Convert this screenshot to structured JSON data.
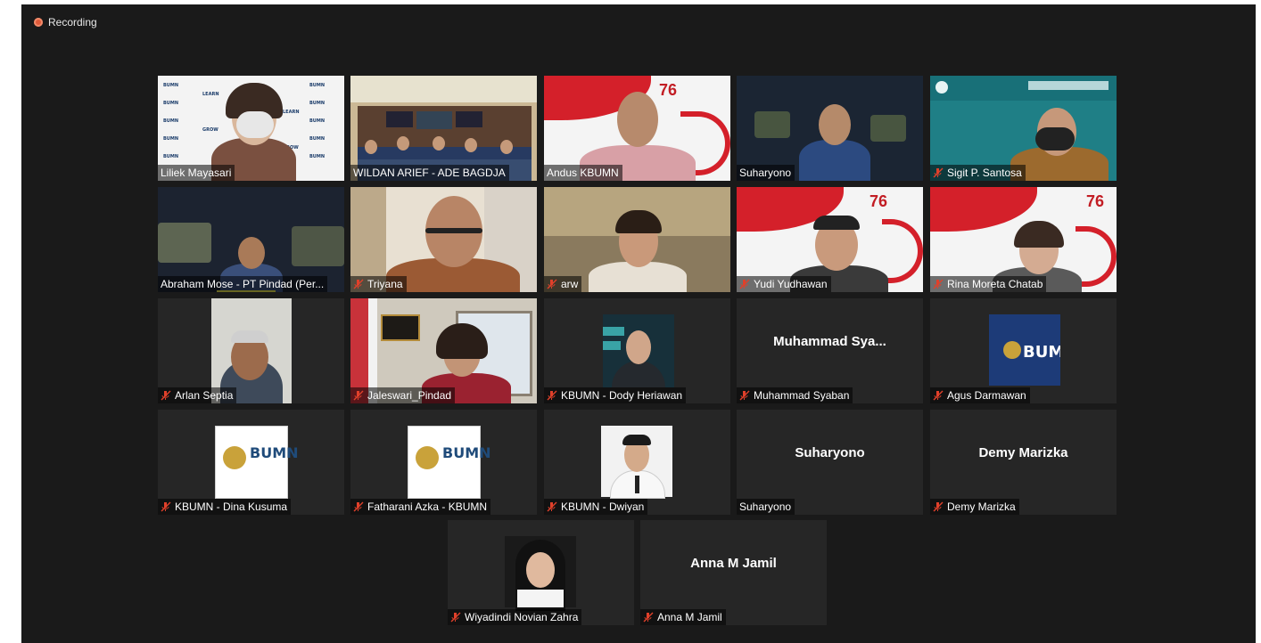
{
  "recording": {
    "label": "Recording"
  },
  "participants": [
    {
      "name": "Liliek Mayasari",
      "muted": false,
      "video": true
    },
    {
      "name": "WILDAN ARIEF - ADE BAGDJA",
      "muted": false,
      "video": true,
      "active_speaker": true
    },
    {
      "name": "Andus KBUMN",
      "muted": false,
      "video": true
    },
    {
      "name": "Suharyono",
      "muted": false,
      "video": true
    },
    {
      "name": "Sigit P. Santosa",
      "muted": true,
      "video": true
    },
    {
      "name": "Abraham Mose - PT Pindad (Per...",
      "muted": false,
      "video": true
    },
    {
      "name": "Triyana",
      "muted": true,
      "video": true
    },
    {
      "name": "arw",
      "muted": true,
      "video": true
    },
    {
      "name": "Yudi Yudhawan",
      "muted": true,
      "video": true
    },
    {
      "name": "Rina Moreta Chatab",
      "muted": true,
      "video": true
    },
    {
      "name": "Arlan Septia",
      "muted": true,
      "video": true
    },
    {
      "name": "Jaleswari_Pindad",
      "muted": true,
      "video": true
    },
    {
      "name": "KBUMN - Dody Heriawan",
      "muted": true,
      "video": true
    },
    {
      "name": "Muhammad Syaban",
      "muted": true,
      "video": false,
      "display_name": "Muhammad  Sya..."
    },
    {
      "name": "Agus Darmawan",
      "muted": true,
      "video": true
    },
    {
      "name": "KBUMN - Dina Kusuma",
      "muted": true,
      "video": true
    },
    {
      "name": "Fatharani Azka - KBUMN",
      "muted": true,
      "video": true
    },
    {
      "name": "KBUMN - Dwiyan",
      "muted": true,
      "video": true
    },
    {
      "name": "Suharyono",
      "muted": false,
      "video": false,
      "display_name": "Suharyono"
    },
    {
      "name": "Demy Marizka",
      "muted": true,
      "video": false,
      "display_name": "Demy Marizka"
    },
    {
      "name": "Wiyadindi Novian Zahra",
      "muted": true,
      "video": true
    },
    {
      "name": "Anna M Jamil",
      "muted": true,
      "video": false,
      "display_name": "Anna M Jamil"
    }
  ],
  "logos": {
    "anniversary": "76",
    "bumn": "BUMN"
  },
  "colors": {
    "window_bg": "#1a1a1a",
    "tile_bg": "#262626",
    "active_outline": "#d6e23a",
    "muted_icon": "#e0402a",
    "recording_dot": "#e05a3a"
  }
}
